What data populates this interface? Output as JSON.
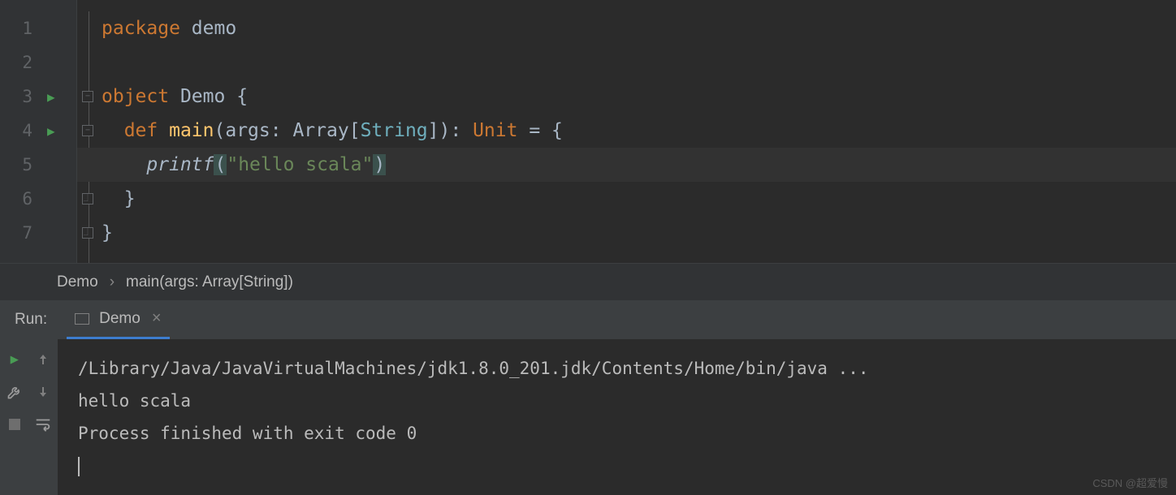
{
  "editor": {
    "lines": [
      {
        "num": "1",
        "runIcon": false
      },
      {
        "num": "2",
        "runIcon": false
      },
      {
        "num": "3",
        "runIcon": true
      },
      {
        "num": "4",
        "runIcon": true
      },
      {
        "num": "5",
        "runIcon": false
      },
      {
        "num": "6",
        "runIcon": false
      },
      {
        "num": "7",
        "runIcon": false
      }
    ],
    "code": {
      "line1": {
        "kw": "package",
        "ident": " demo"
      },
      "line3": {
        "kw": "object",
        "name": " Demo ",
        "brace": "{"
      },
      "line4": {
        "indent": "  ",
        "def": "def",
        "name": " main",
        "lparen": "(",
        "arg": "args: ",
        "arrtype": "Array",
        "lbr": "[",
        "strtype": "String",
        "rbr": "]",
        "rparen": ")",
        "colon": ": ",
        "unit": "Unit",
        "eq": " = {",
        "brace": ""
      },
      "line5": {
        "indent": "    ",
        "fn": "printf",
        "lp": "(",
        "str": "\"hello scala\"",
        "rp": ")"
      },
      "line6": {
        "indent": "  ",
        "brace": "}"
      },
      "line7": {
        "brace": "}"
      }
    }
  },
  "breadcrumb": {
    "item1": "Demo",
    "item2": "main(args: Array[String])"
  },
  "runPanel": {
    "label": "Run:",
    "tabName": "Demo"
  },
  "console": {
    "line1": "/Library/Java/JavaVirtualMachines/jdk1.8.0_201.jdk/Contents/Home/bin/java ...",
    "line2": "hello scala",
    "line3": "Process finished with exit code 0"
  },
  "watermark": "CSDN @超爱慢"
}
